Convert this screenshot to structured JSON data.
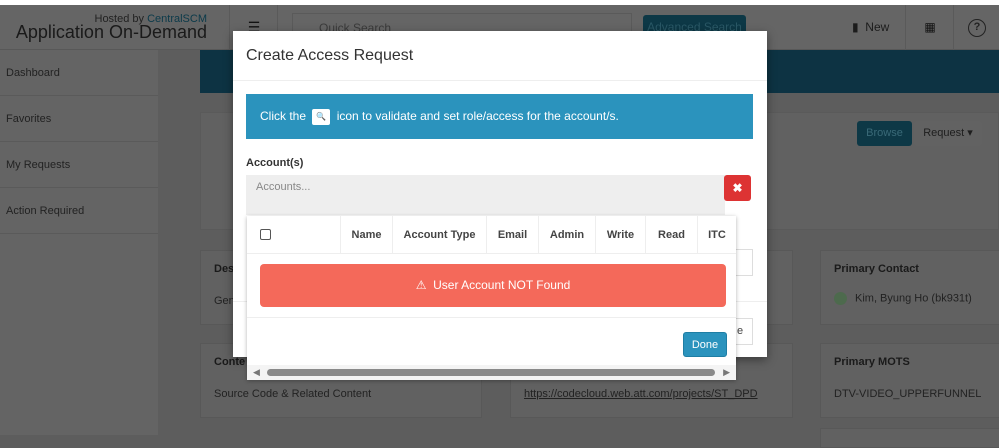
{
  "header": {
    "hosted_by": "Hosted by",
    "hosted_brand": "CentralSCM",
    "app_name": "Application On-Demand",
    "menu_icon": "☰",
    "quick_search_placeholder": "Quick Search",
    "advanced_search": "Advanced Search",
    "new_label": "New",
    "calendar_icon": "▦",
    "help_icon": "?"
  },
  "sidebar": {
    "items": [
      {
        "label": "Dashboard"
      },
      {
        "label": "Favorites"
      },
      {
        "label": "My Requests"
      },
      {
        "label": "Action Required"
      }
    ]
  },
  "page": {
    "browse": "Browse",
    "request": "Request ▾",
    "cards": [
      {
        "title": "Des",
        "value": "Gen"
      },
      {
        "title": "Conte",
        "value": "Source Code & Related Content"
      },
      {
        "title": "",
        "value": "https://codecloud.web.att.com/projects/ST_DPD"
      },
      {
        "title": "Primary Contact",
        "value": "Kim, Byung Ho (bk931t)"
      },
      {
        "title": "Primary MOTS",
        "value": "DTV-VIDEO_UPPERFUNNEL"
      }
    ]
  },
  "modal": {
    "title": "Create Access Request",
    "info_pre": "Click the",
    "info_icon": "🔍",
    "info_post": "icon to validate and set role/access for the account/s.",
    "accounts_label": "Account(s)",
    "accounts_placeholder": "Accounts...",
    "clear_icon": "✖",
    "columns": [
      "Name",
      "Account Type",
      "Email",
      "Admin",
      "Write",
      "Read",
      "ITC"
    ],
    "alert_icon": "⚠",
    "alert": "User Account NOT Found",
    "done": "Done",
    "behind_label": "e"
  }
}
